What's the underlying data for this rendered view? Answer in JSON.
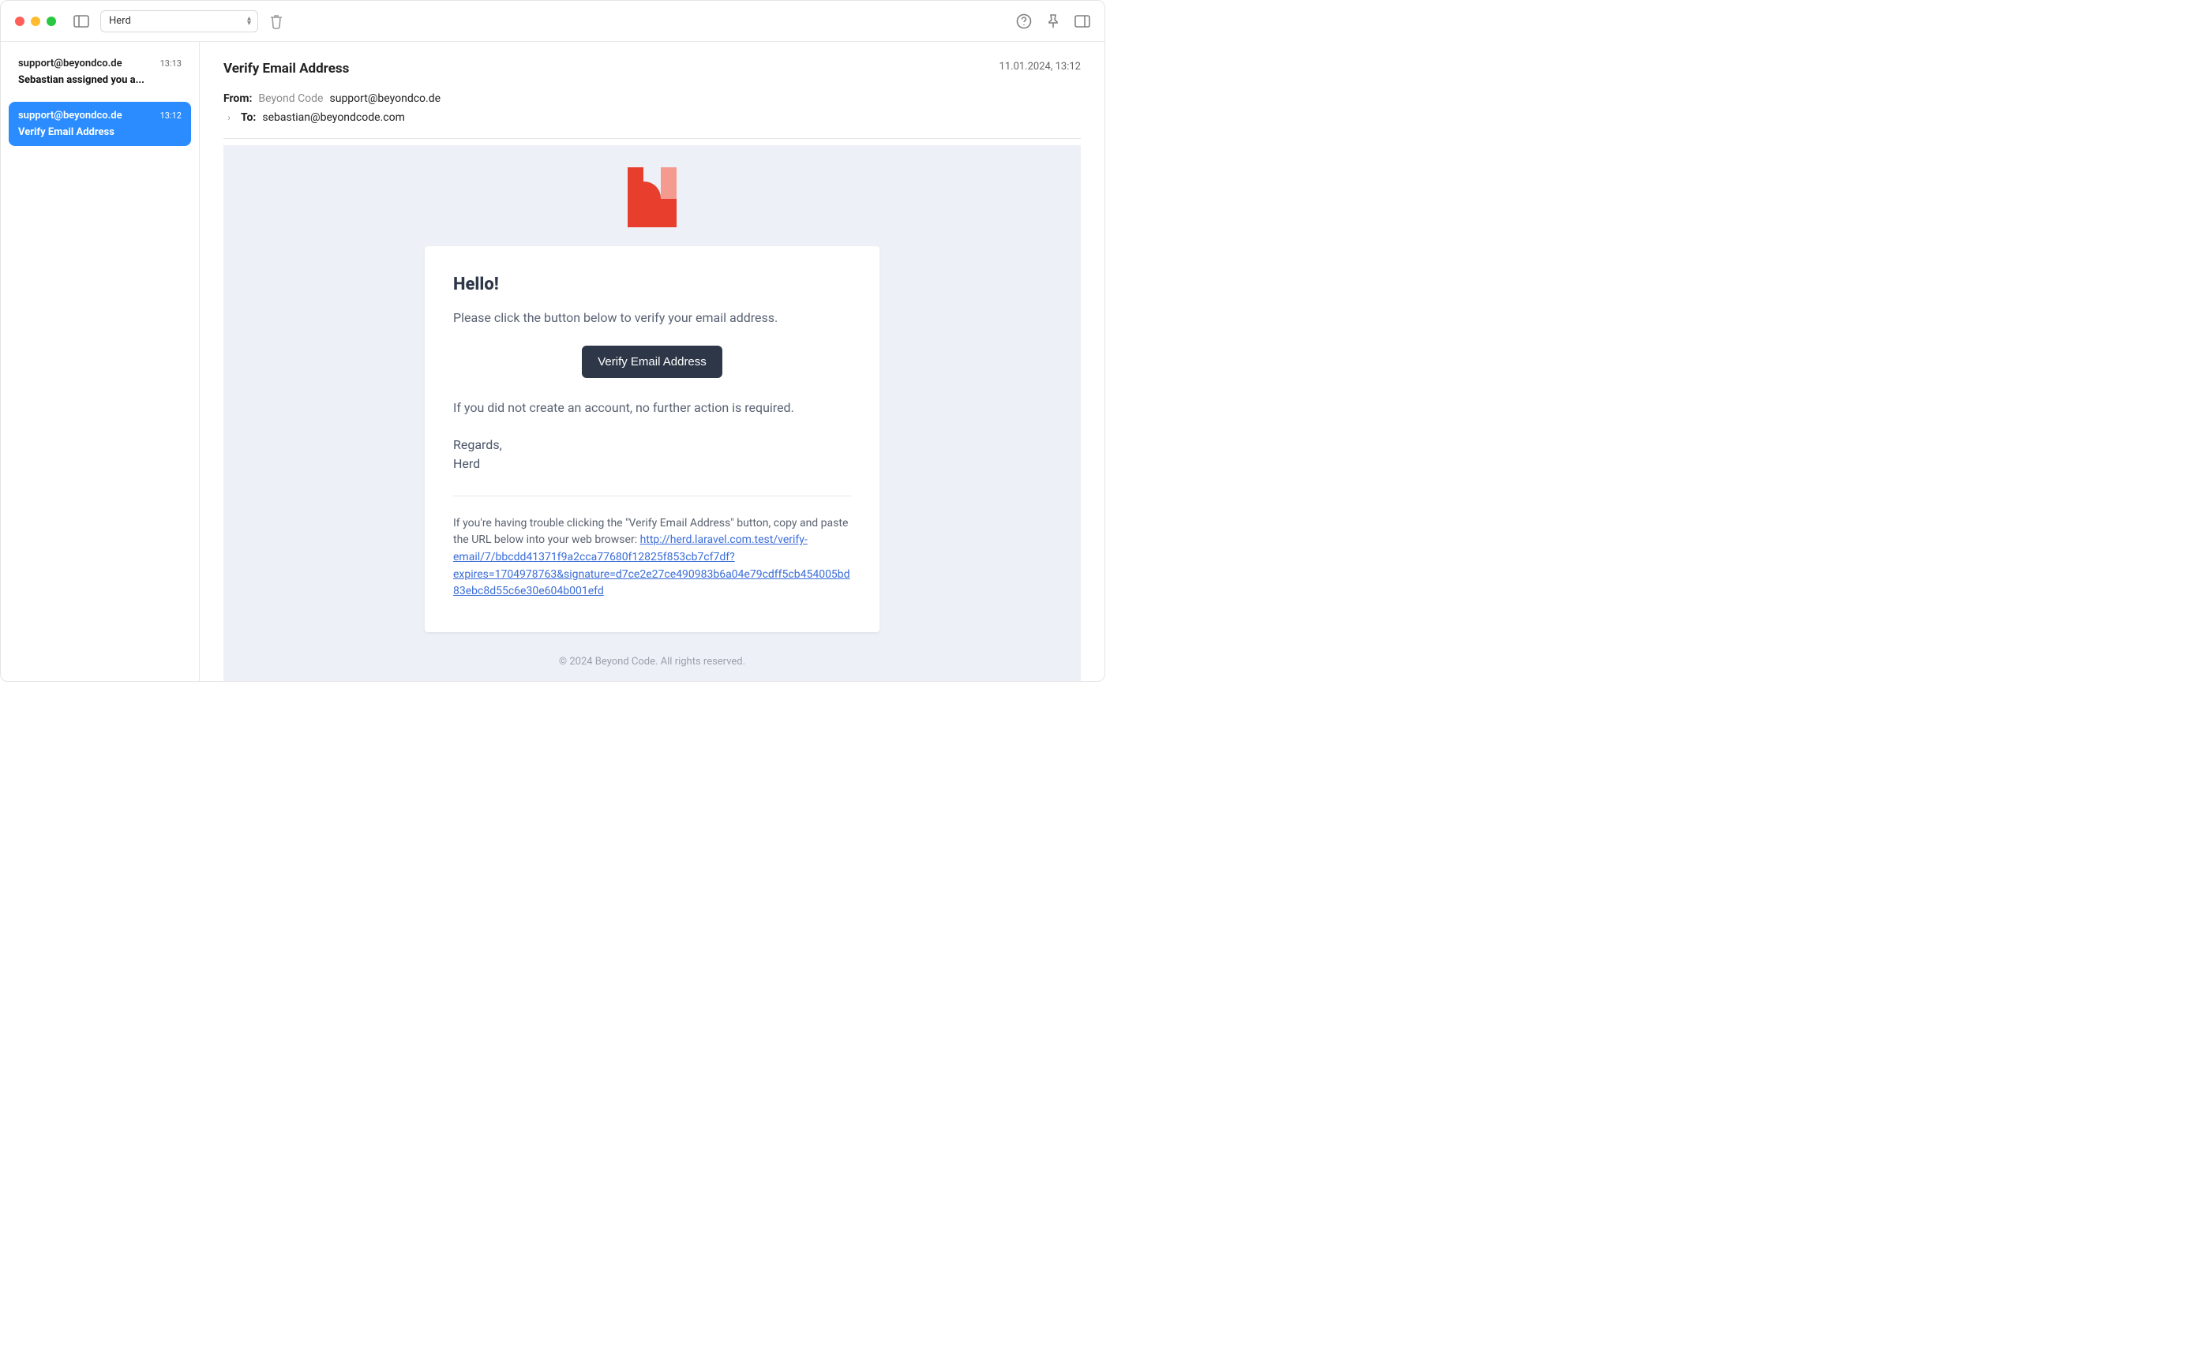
{
  "toolbar": {
    "select_value": "Herd"
  },
  "sidebar": {
    "items": [
      {
        "from": "support@beyondco.de",
        "time": "13:13",
        "subject": "Sebastian assigned you a...",
        "selected": false
      },
      {
        "from": "support@beyondco.de",
        "time": "13:12",
        "subject": "Verify Email Address",
        "selected": true
      }
    ]
  },
  "mail": {
    "title": "Verify Email Address",
    "date": "11.01.2024, 13:12",
    "from_label": "From:",
    "from_name": "Beyond Code",
    "from_email": "support@beyondco.de",
    "to_label": "To:",
    "to_email": "sebastian@beyondcode.com"
  },
  "body": {
    "greeting": "Hello!",
    "intro": "Please click the button below to verify your email address.",
    "cta_label": "Verify Email Address",
    "no_action": "If you did not create an account, no further action is required.",
    "regards_line1": "Regards,",
    "regards_line2": "Herd",
    "trouble_prefix": "If you're having trouble clicking the \"Verify Email Address\" button, copy and paste the URL below into your web browser: ",
    "url": "http://herd.laravel.com.test/verify-email/7/bbcdd41371f9a2cca77680f12825f853cb7cf7df?expires=1704978763&signature=d7ce2e27ce490983b6a04e79cdff5cb454005bd83ebc8d55c6e30e604b001efd",
    "footer": "© 2024 Beyond Code. All rights reserved."
  }
}
